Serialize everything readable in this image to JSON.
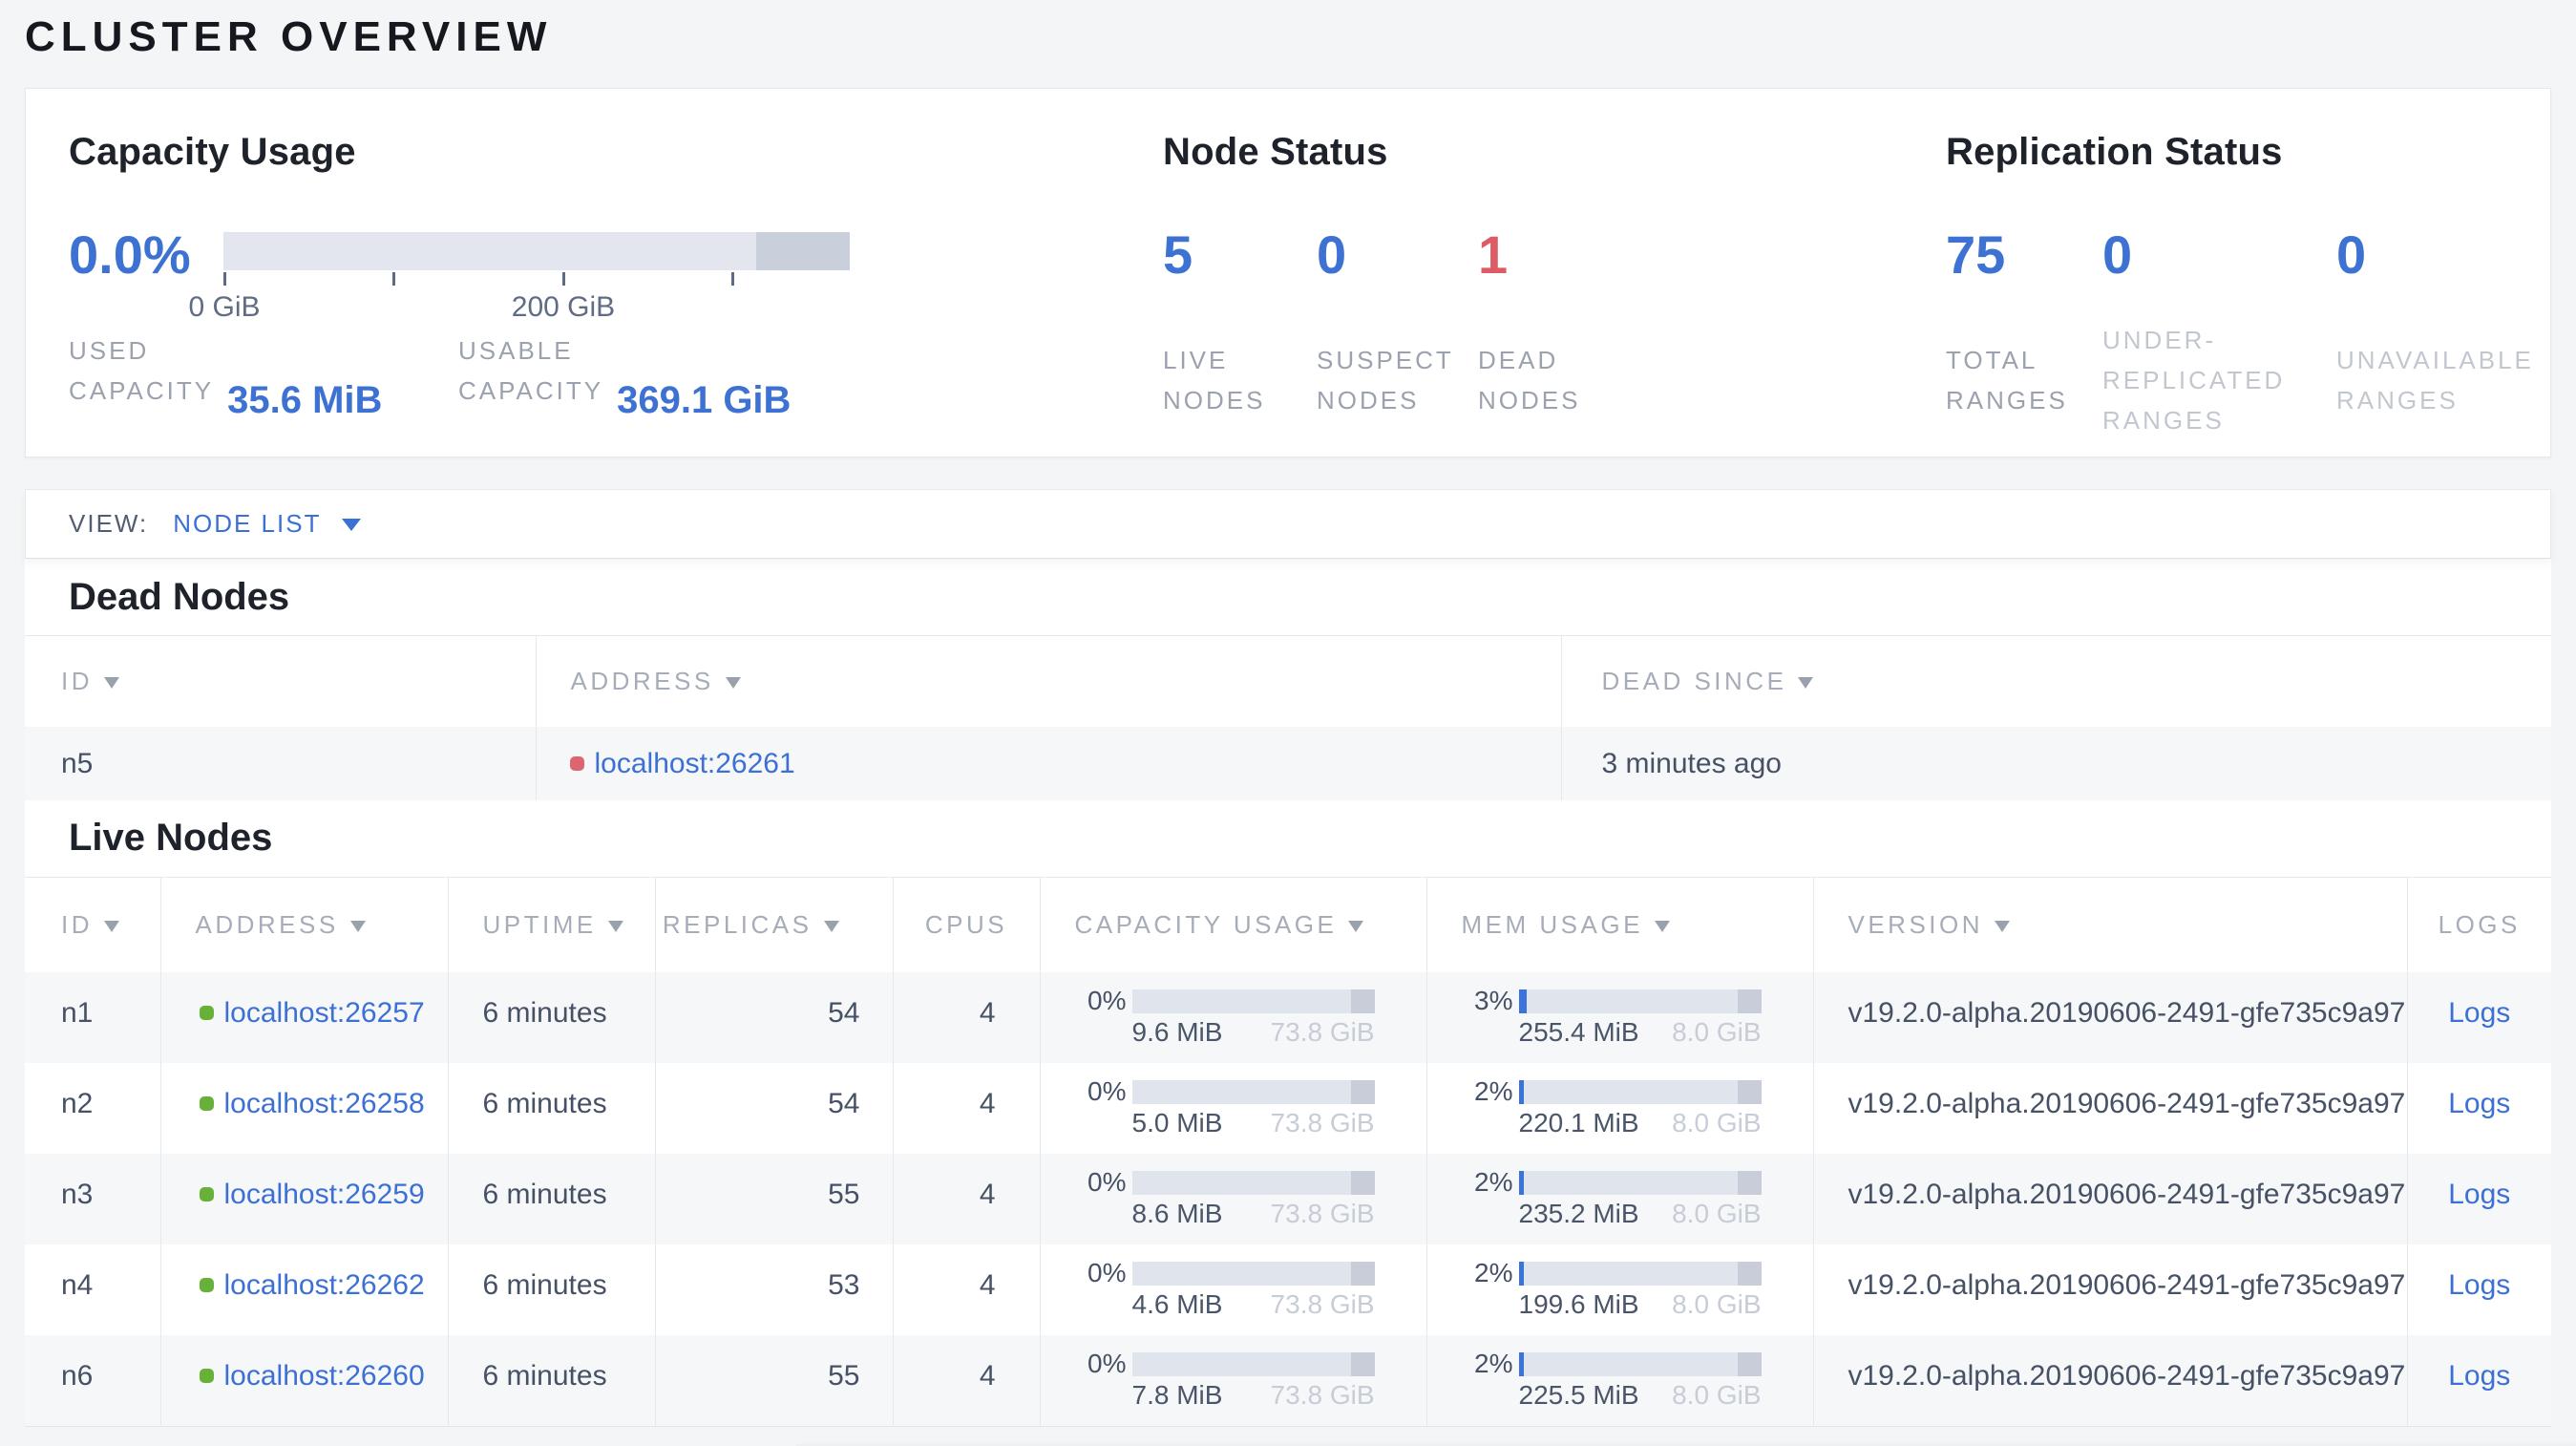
{
  "page": {
    "title": "CLUSTER OVERVIEW"
  },
  "summary": {
    "capacity": {
      "heading": "Capacity Usage",
      "percent": "0.0%",
      "bar": {
        "usable_width_pct": 85,
        "reserved_width_pct": 15
      },
      "axis": {
        "tick_labels": [
          "0 GiB",
          "200 GiB"
        ]
      },
      "stats": [
        {
          "label_line1": "USED",
          "label_line2": "CAPACITY",
          "value": "35.6 MiB"
        },
        {
          "label_line1": "USABLE",
          "label_line2": "CAPACITY",
          "value": "369.1 GiB"
        }
      ]
    },
    "node_status": {
      "heading": "Node Status",
      "metrics": [
        {
          "value": "5",
          "label_line1": "LIVE",
          "label_line2": "NODES"
        },
        {
          "value": "0",
          "label_line1": "SUSPECT",
          "label_line2": "NODES"
        },
        {
          "value": "1",
          "label_line1": "DEAD",
          "label_line2": "NODES"
        }
      ]
    },
    "replication": {
      "heading": "Replication Status",
      "metrics": [
        {
          "value": "75",
          "label_line1": "TOTAL",
          "label_line2": "RANGES"
        },
        {
          "value": "0",
          "label_line1": "UNDER-",
          "label_line2": "REPLICATED",
          "label_line3": "RANGES"
        },
        {
          "value": "0",
          "label_line1": "UNAVAILABLE",
          "label_line2": "RANGES"
        }
      ]
    }
  },
  "view_bar": {
    "label": "VIEW:",
    "selected": "NODE LIST"
  },
  "dead_nodes": {
    "heading": "Dead Nodes",
    "columns": {
      "id": "ID",
      "address": "ADDRESS",
      "dead_since": "DEAD SINCE"
    },
    "rows": [
      {
        "id": "n5",
        "address": "localhost:26261",
        "dead_since": "3 minutes ago"
      }
    ]
  },
  "live_nodes": {
    "heading": "Live Nodes",
    "columns": {
      "id": "ID",
      "address": "ADDRESS",
      "uptime": "UPTIME",
      "replicas": "REPLICAS",
      "cpus": "CPUS",
      "capacity": "CAPACITY USAGE",
      "memory": "MEM USAGE",
      "version": "VERSION",
      "logs": "LOGS"
    },
    "rows": [
      {
        "id": "n1",
        "address": "localhost:26257",
        "uptime": "6 minutes",
        "replicas": "54",
        "cpus": "4",
        "capacity": {
          "pct": "0%",
          "fill": 0,
          "used": "9.6 MiB",
          "total": "73.8 GiB"
        },
        "memory": {
          "pct": "3%",
          "fill": 3,
          "used": "255.4 MiB",
          "total": "8.0 GiB"
        },
        "version": "v19.2.0-alpha.20190606-2491-gfe735c9a97",
        "logs": "Logs"
      },
      {
        "id": "n2",
        "address": "localhost:26258",
        "uptime": "6 minutes",
        "replicas": "54",
        "cpus": "4",
        "capacity": {
          "pct": "0%",
          "fill": 0,
          "used": "5.0 MiB",
          "total": "73.8 GiB"
        },
        "memory": {
          "pct": "2%",
          "fill": 2,
          "used": "220.1 MiB",
          "total": "8.0 GiB"
        },
        "version": "v19.2.0-alpha.20190606-2491-gfe735c9a97",
        "logs": "Logs"
      },
      {
        "id": "n3",
        "address": "localhost:26259",
        "uptime": "6 minutes",
        "replicas": "55",
        "cpus": "4",
        "capacity": {
          "pct": "0%",
          "fill": 0,
          "used": "8.6 MiB",
          "total": "73.8 GiB"
        },
        "memory": {
          "pct": "2%",
          "fill": 2,
          "used": "235.2 MiB",
          "total": "8.0 GiB"
        },
        "version": "v19.2.0-alpha.20190606-2491-gfe735c9a97",
        "logs": "Logs"
      },
      {
        "id": "n4",
        "address": "localhost:26262",
        "uptime": "6 minutes",
        "replicas": "53",
        "cpus": "4",
        "capacity": {
          "pct": "0%",
          "fill": 0,
          "used": "4.6 MiB",
          "total": "73.8 GiB"
        },
        "memory": {
          "pct": "2%",
          "fill": 2,
          "used": "199.6 MiB",
          "total": "8.0 GiB"
        },
        "version": "v19.2.0-alpha.20190606-2491-gfe735c9a97",
        "logs": "Logs"
      },
      {
        "id": "n6",
        "address": "localhost:26260",
        "uptime": "6 minutes",
        "replicas": "55",
        "cpus": "4",
        "capacity": {
          "pct": "0%",
          "fill": 0,
          "used": "7.8 MiB",
          "total": "73.8 GiB"
        },
        "memory": {
          "pct": "2%",
          "fill": 2,
          "used": "225.5 MiB",
          "total": "8.0 GiB"
        },
        "version": "v19.2.0-alpha.20190606-2491-gfe735c9a97",
        "logs": "Logs"
      }
    ]
  },
  "colors": {
    "accent_blue": "#3d72d3",
    "alert_red": "#dd5b64",
    "live_green": "#68b139",
    "dead_red": "#dd6570"
  }
}
